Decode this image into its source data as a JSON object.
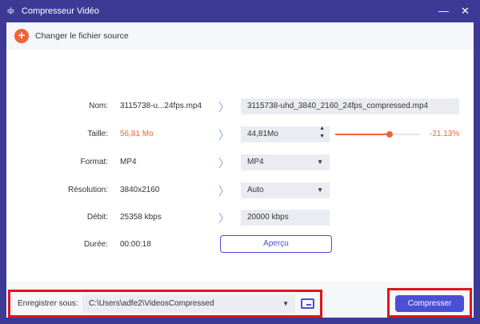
{
  "window": {
    "title": "Compresseur Vidéo",
    "minimize": "—",
    "close": "✕"
  },
  "header": {
    "change_source": "Changer le fichier source"
  },
  "rows": [
    {
      "label": "Nom:",
      "source": "3115738-u...24fps.mp4",
      "target": "3115738-uhd_3840_2160_24fps_compressed.mp4"
    },
    {
      "label": "Taille:",
      "source": "56,81 Mo",
      "target": "44,81Mo",
      "percent": "-21.13%",
      "slider_fraction": 0.64
    },
    {
      "label": "Format:",
      "source": "MP4",
      "target": "MP4"
    },
    {
      "label": "Résolution:",
      "source": "3840x2160",
      "target": "Auto"
    },
    {
      "label": "Débit:",
      "source": "25358 kbps",
      "target": "20000 kbps"
    },
    {
      "label": "Durée:",
      "source": "00:00:18",
      "target": "Aperçu"
    }
  ],
  "footer": {
    "save_label": "Enregistrer sous:",
    "save_path": "C:\\Users\\adfe2\\VideosCompressed",
    "compress": "Compresser"
  },
  "colors": {
    "accent": "#f4623a",
    "brand": "#3d3a96",
    "button": "#4b4fd6"
  }
}
